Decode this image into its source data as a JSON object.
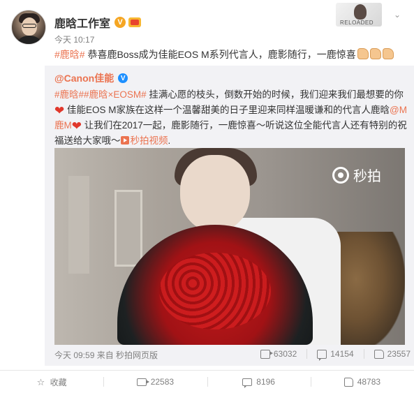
{
  "post": {
    "author": "鹿晗工作室",
    "verified_mark": "V",
    "time": "今天 10:17",
    "hashtag": "#鹿晗#",
    "text": " 恭喜鹿Boss成为佳能EOS M系列代言人，鹿影随行，一鹿惊喜",
    "dropdown_icon": "chevron-down-icon",
    "top_right_caption": "RELOADED"
  },
  "repost": {
    "author": "@Canon佳能",
    "verified_mark": "V",
    "hashtags": "#鹿晗##鹿晗×EOSM#",
    "text_1": " 挂满心愿的枝头，倒数开始的时候，我们迎来我们最想要的你",
    "text_2": "佳能EOS M家族在这样一个温馨甜美的日子里迎来同样温暖谦和的代言人鹿晗",
    "mention": "@M鹿M",
    "text_3": "让我们在2017一起，鹿影随行，一鹿惊喜～听说这位全能代言人还有特别的祝福送给大家哦～",
    "video_link": "秒拍视频",
    "period": ".",
    "watermark": "秒拍",
    "footer_source": "今天 09:59 来自 秒拍网页版",
    "forward_count": "63032",
    "comment_count": "14154",
    "like_count": "23557"
  },
  "actions": {
    "favorite_label": "收藏",
    "forward_count": "22583",
    "comment_count": "8196",
    "like_count": "48783"
  }
}
